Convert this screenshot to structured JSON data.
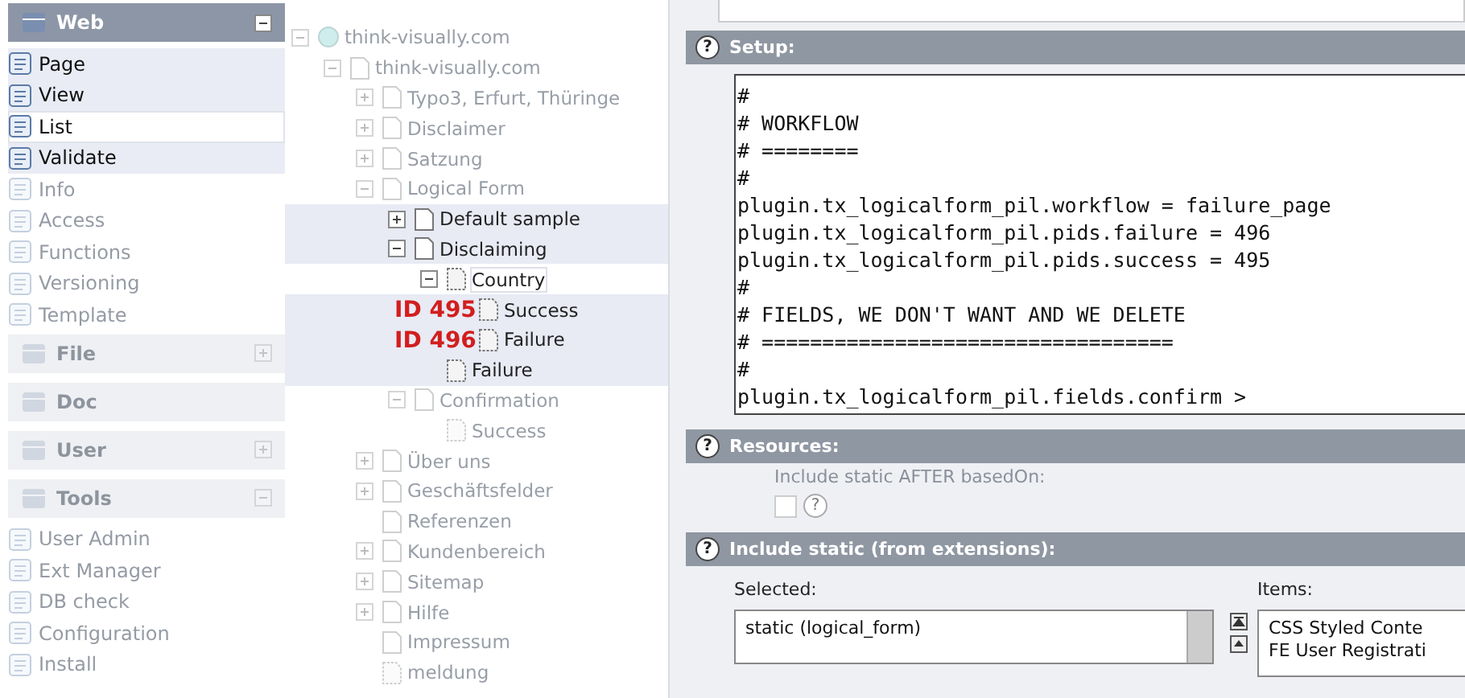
{
  "sidebar": {
    "groups": [
      {
        "title": "Web",
        "expanded": true,
        "dimmed": false,
        "items": [
          {
            "label": "Page",
            "selected": false,
            "dimmed": false
          },
          {
            "label": "View",
            "selected": false,
            "dimmed": false
          },
          {
            "label": "List",
            "selected": true,
            "dimmed": false
          },
          {
            "label": "Validate",
            "selected": false,
            "dimmed": false
          },
          {
            "label": "Info",
            "selected": false,
            "dimmed": true
          },
          {
            "label": "Access",
            "selected": false,
            "dimmed": true
          },
          {
            "label": "Functions",
            "selected": false,
            "dimmed": true
          },
          {
            "label": "Versioning",
            "selected": false,
            "dimmed": true
          },
          {
            "label": "Template",
            "selected": false,
            "dimmed": true
          }
        ]
      },
      {
        "title": "File",
        "expanded": false,
        "dimmed": true
      },
      {
        "title": "Doc",
        "dimmed": true
      },
      {
        "title": "User",
        "expanded": false,
        "dimmed": true
      },
      {
        "title": "Tools",
        "expanded": true,
        "dimmed": true,
        "items": [
          {
            "label": "User Admin",
            "selected": false,
            "dimmed": true
          },
          {
            "label": "Ext Manager",
            "selected": false,
            "dimmed": true
          },
          {
            "label": "DB check",
            "selected": false,
            "dimmed": true
          },
          {
            "label": "Configuration",
            "selected": false,
            "dimmed": true
          },
          {
            "label": "Install",
            "selected": false,
            "dimmed": true
          }
        ]
      }
    ]
  },
  "page_tree": [
    {
      "label": "think-visually.com",
      "kind": "site",
      "expanded": true,
      "selected": false,
      "dimmed": true,
      "children": [
        {
          "label": "think-visually.com",
          "kind": "page",
          "expanded": true,
          "selected": false,
          "dimmed": true,
          "children": [
            {
              "label": "Typo3, Erfurt, Thüringe",
              "kind": "page",
              "expanded": false,
              "selected": false,
              "dimmed": true
            },
            {
              "label": "Disclaimer",
              "kind": "page",
              "expanded": false,
              "selected": false,
              "dimmed": true
            },
            {
              "label": "Satzung",
              "kind": "page",
              "expanded": false,
              "selected": false,
              "dimmed": true
            },
            {
              "label": "Logical Form",
              "kind": "page",
              "expanded": true,
              "selected": false,
              "dimmed": true,
              "children": [
                {
                  "label": "Default sample",
                  "kind": "page",
                  "expanded": false,
                  "selected": false,
                  "dimmed": false
                },
                {
                  "label": "Disclaiming",
                  "kind": "page",
                  "expanded": true,
                  "selected": false,
                  "dimmed": false,
                  "children": [
                    {
                      "label": "Country",
                      "kind": "hidden",
                      "expanded": true,
                      "selected": true,
                      "dimmed": false,
                      "children": [
                        {
                          "label": "Success",
                          "kind": "hidden",
                          "selected": false,
                          "dimmed": false,
                          "annotation": "ID 495"
                        },
                        {
                          "label": "Failure",
                          "kind": "hidden",
                          "selected": false,
                          "dimmed": false,
                          "annotation": "ID 496"
                        }
                      ]
                    },
                    {
                      "label": "Failure",
                      "kind": "hidden",
                      "selected": false,
                      "dimmed": false
                    }
                  ]
                },
                {
                  "label": "Confirmation",
                  "kind": "page",
                  "expanded": true,
                  "selected": false,
                  "dimmed": true,
                  "children": [
                    {
                      "label": "Success",
                      "kind": "hidden",
                      "selected": false,
                      "dimmed": true
                    }
                  ]
                }
              ]
            },
            {
              "label": "Über uns",
              "kind": "page",
              "expanded": false,
              "selected": false,
              "dimmed": true
            },
            {
              "label": "Geschäftsfelder",
              "kind": "page",
              "expanded": false,
              "selected": false,
              "dimmed": true
            },
            {
              "label": "Referenzen",
              "kind": "page",
              "selected": false,
              "dimmed": true
            },
            {
              "label": "Kundenbereich",
              "kind": "page",
              "expanded": false,
              "selected": false,
              "dimmed": true
            },
            {
              "label": "Sitemap",
              "kind": "page",
              "expanded": false,
              "selected": false,
              "dimmed": true
            },
            {
              "label": "Hilfe",
              "kind": "page",
              "expanded": false,
              "selected": false,
              "dimmed": true
            },
            {
              "label": "Impressum",
              "kind": "page",
              "selected": false,
              "dimmed": true
            },
            {
              "label": "meldung",
              "kind": "hidden",
              "selected": false,
              "dimmed": true
            }
          ]
        }
      ]
    }
  ],
  "setup": {
    "help": "?",
    "title": "Setup:",
    "code_lines": [
      "#",
      "# WORKFLOW",
      "# ========",
      "#",
      "plugin.tx_logicalform_pil.workflow = failure_page",
      "plugin.tx_logicalform_pil.pids.failure = 496",
      "plugin.tx_logicalform_pil.pids.success = 495",
      "#",
      "# FIELDS, WE DON'T WANT AND WE DELETE",
      "# ==================================",
      "#",
      "plugin.tx_logicalform_pil.fields.confirm >"
    ]
  },
  "resources": {
    "help": "?",
    "title": "Resources:",
    "option_label": "Include static AFTER basedOn:",
    "checked": false,
    "option_help": "?"
  },
  "include_static": {
    "help": "?",
    "title": "Include static (from extensions):",
    "selected_label": "Selected:",
    "items_label": "Items:",
    "selected": [
      "static (logical_form)"
    ],
    "items": [
      "CSS Styled Conte",
      "FE User Registrati"
    ]
  }
}
